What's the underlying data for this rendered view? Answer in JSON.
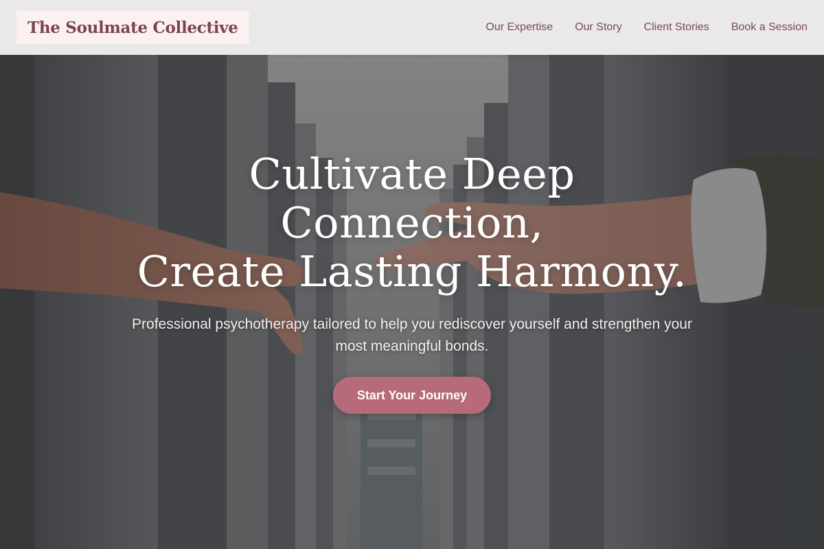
{
  "brand": {
    "name": "The Soulmate Collective"
  },
  "nav": {
    "items": [
      {
        "label": "Our Expertise"
      },
      {
        "label": "Our Story"
      },
      {
        "label": "Client Stories"
      },
      {
        "label": "Book a Session"
      }
    ]
  },
  "hero": {
    "title_lines": [
      "Cultivate Deep",
      "Connection,",
      "Create Lasting Harmony."
    ],
    "subtitle": "Professional psychotherapy tailored to help you rediscover yourself and strengthen your most meaningful bonds.",
    "cta_label": "Start Your Journey",
    "image": "reaching-hands-photo"
  },
  "colors": {
    "brand": "#7c4453",
    "logo_bg": "#fcf1f1",
    "nav_text": "#7c4a55",
    "cta_bg": "#b76a79",
    "header_bg": "#f6f4f4"
  }
}
